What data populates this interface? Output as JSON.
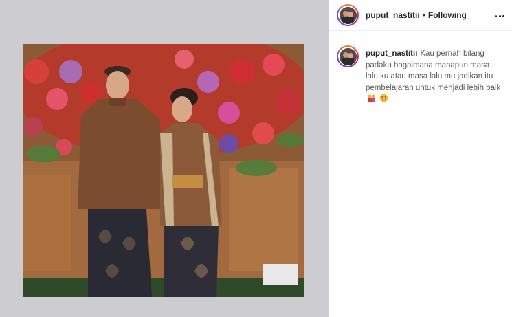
{
  "post": {
    "username": "puput_nastitii",
    "separator": "•",
    "follow_status": "Following",
    "caption_text": "Kau pernah bilang padaku bagaimana manapun masa lalu ku atau masa lalu mu jadikan itu pembelajaran untuk menjadi lebih baik",
    "caption_emojis": [
      "couple-emoji",
      "smiling-face-hearts-emoji"
    ]
  },
  "colors": {
    "media_background": "#cdcdd1",
    "border": "#efefef",
    "text_primary": "#262626"
  },
  "icons": [
    "more-options-icon",
    "avatar"
  ]
}
